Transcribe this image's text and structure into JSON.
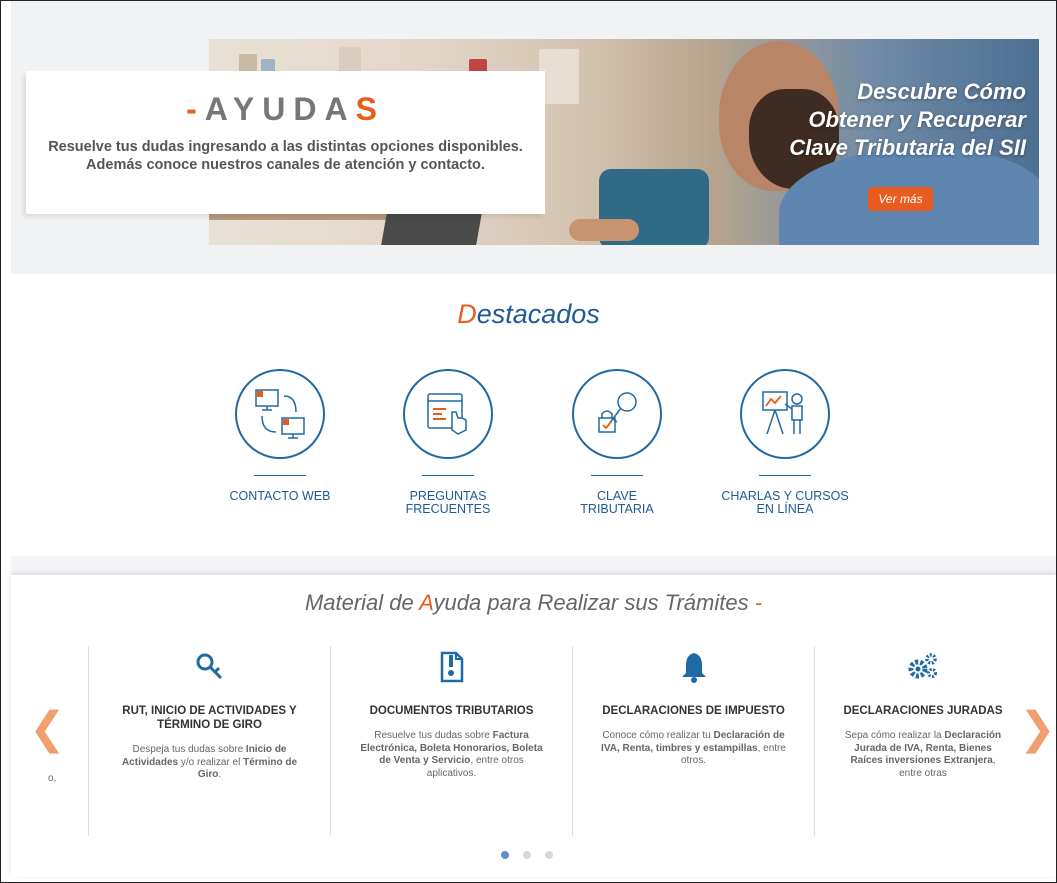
{
  "hero": {
    "title_prefix": "-",
    "title_main": "AYUDA",
    "title_suffix": "S",
    "description": "Resuelve tus dudas ingresando a las distintas opciones disponibles. Además conoce nuestros canales de atención y contacto.",
    "promo_lines": [
      "Descubre Cómo",
      "Obtener y Recuperar",
      "Clave Tributaria del SII"
    ],
    "promo_button": "Ver más"
  },
  "destacados": {
    "title_first": "D",
    "title_rest": "estacados",
    "items": [
      {
        "label_line1": "CONTACTO WEB",
        "label_line2": "",
        "icon": "computers-sync-icon"
      },
      {
        "label_line1": "PREGUNTAS",
        "label_line2": "FRECUENTES",
        "icon": "browser-hand-icon"
      },
      {
        "label_line1": "CLAVE",
        "label_line2": "TRIBUTARIA",
        "icon": "key-lock-icon"
      },
      {
        "label_line1": "CHARLAS Y CURSOS",
        "label_line2": "EN LÍNEA",
        "icon": "presentation-icon"
      }
    ]
  },
  "material": {
    "title_part1": "Material de ",
    "title_highlight": "A",
    "title_part2": "yuda para Realizar sus Trámites",
    "title_dash": " -",
    "partial_text": "o,",
    "cards": [
      {
        "title": "RUT, INICIO DE ACTIVIDADES Y TÉRMINO DE GIRO",
        "desc_a": "Despeja tus dudas sobre ",
        "desc_b": "Inicio de Actividades",
        "desc_c": " y/o realizar el ",
        "desc_d": "Término de Giro",
        "desc_e": ".",
        "icon": "magnifier-key-icon"
      },
      {
        "title": "DOCUMENTOS TRIBUTARIOS",
        "desc_a": "Resuelve tus dudas sobre ",
        "desc_b": "Factura Electrónica, Boleta Honorarios, Boleta de Venta y Servicio",
        "desc_c": ", entre otros aplicativos.",
        "desc_d": "",
        "desc_e": "",
        "icon": "document-icon"
      },
      {
        "title": "DECLARACIONES DE IMPUESTO",
        "desc_a": "Conoce cómo realizar tu ",
        "desc_b": "Declaración de IVA, Renta, timbres y estampillas",
        "desc_c": ", entre otros.",
        "desc_d": "",
        "desc_e": "",
        "icon": "bell-icon"
      },
      {
        "title": "DECLARACIONES JURADAS",
        "desc_a": "Sepa cómo realizar la ",
        "desc_b": "Declaración Jurada de IVA, Renta, Bienes Raíces",
        "desc_c": " inversiones Extranjera",
        "desc_d": ", entre otras",
        "desc_e": "",
        "icon": "gears-icon"
      }
    ],
    "dots": 3,
    "active_dot": 1
  },
  "colors": {
    "accent": "#e85d1f",
    "primary": "#1f5a96"
  }
}
